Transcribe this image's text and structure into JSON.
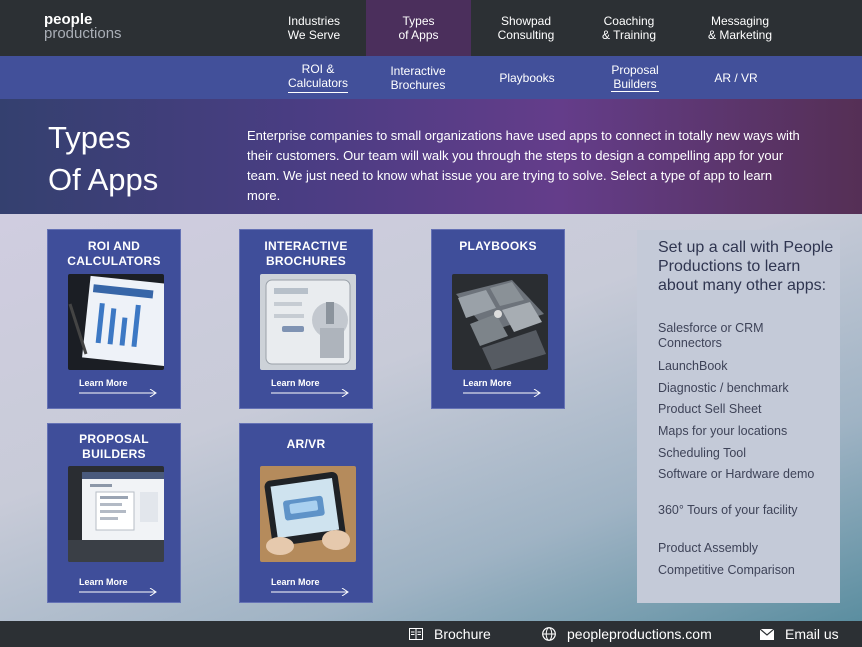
{
  "brand": {
    "line1": "people",
    "line2": "productions"
  },
  "top_nav": [
    {
      "line1": "Industries",
      "line2": "We Serve"
    },
    {
      "line1": "Types",
      "line2": "of Apps"
    },
    {
      "line1": "Showpad",
      "line2": "Consulting"
    },
    {
      "line1": "Coaching",
      "line2": "& Training"
    },
    {
      "line1": "Messaging",
      "line2": "& Marketing"
    }
  ],
  "sub_nav": [
    {
      "line1": "ROI &",
      "line2": "Calculators"
    },
    {
      "line1": "Interactive",
      "line2": "Brochures"
    },
    {
      "line1": "Playbooks",
      "line2": ""
    },
    {
      "line1": "Proposal",
      "line2": "Builders"
    },
    {
      "line1": "AR / VR",
      "line2": ""
    }
  ],
  "hero": {
    "title_line1": "Types",
    "title_line2": "Of Apps",
    "text": "Enterprise companies to small organizations have used apps to connect in totally new ways with their customers. Our team will walk you through the steps to design a compelling app for your team. We just need to know what issue you are trying to solve. Select a type of app to learn more."
  },
  "cards": [
    {
      "line1": "ROI AND",
      "line2": "CALCULATORS",
      "link": "Learn More",
      "image": "tablet-roi-chart"
    },
    {
      "line1": "INTERACTIVE",
      "line2": "BROCHURES",
      "link": "Learn More",
      "image": "tablet-brochure-robot"
    },
    {
      "line1": "PLAYBOOKS",
      "line2": "",
      "link": "Learn More",
      "image": "tablet-playbook-tiles"
    },
    {
      "line1": "PROPOSAL",
      "line2": "BUILDERS",
      "link": "Learn More",
      "image": "tablet-proposal-menu"
    },
    {
      "line1": "AR/VR",
      "line2": "",
      "link": "Learn More",
      "image": "tablet-ar-device"
    }
  ],
  "sidebar": {
    "title": "Set up a call with People Productions to learn about many other apps:",
    "items": [
      "Salesforce or CRM Connectors",
      "LaunchBook",
      "Diagnostic / benchmark",
      "Product Sell Sheet",
      "Maps for your locations",
      "Scheduling Tool",
      "Software or Hardware demo",
      "360° Tours of your facility",
      "Product Assembly",
      "Competitive Comparison"
    ]
  },
  "footer": [
    {
      "label": "Brochure",
      "icon": "brochure-icon"
    },
    {
      "label": "peopleproductions.com",
      "icon": "globe-icon"
    },
    {
      "label": "Email us",
      "icon": "envelope-icon"
    }
  ],
  "colors": {
    "nav_bg": "#2c3034",
    "subnav_bg": "#42509a",
    "active_tab": "#4b2f5c",
    "card_bg": "#3f4e9a",
    "sidebar_bg": "#c4cad8"
  }
}
